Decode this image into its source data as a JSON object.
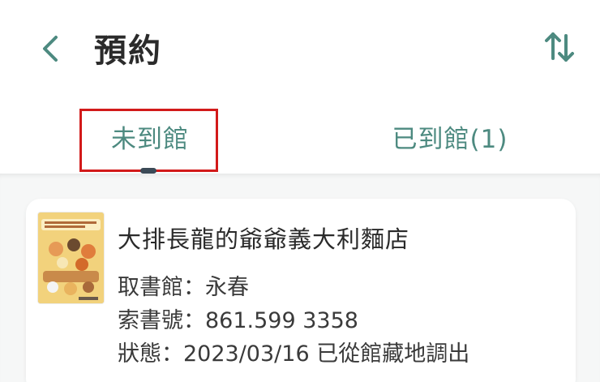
{
  "header": {
    "title": "預約",
    "back_icon": "chevron-left-icon",
    "sort_icon": "sort-arrows-icon"
  },
  "tabs": [
    {
      "label": "未到館",
      "selected": true
    },
    {
      "label": "已到館(1)",
      "selected": false
    }
  ],
  "reservation": {
    "title": "大排長龍的爺爺義大利麵店",
    "pickup_label": "取書館：",
    "pickup_value": "永春",
    "callno_label": "索書號：",
    "callno_value": "861.599 3358",
    "status_label": "狀態：",
    "status_value": "2023/03/16 已從館藏地調出"
  },
  "colors": {
    "accent": "#4d8a80",
    "highlight_box": "#d21a1a",
    "title_text": "#2b2b2b"
  }
}
